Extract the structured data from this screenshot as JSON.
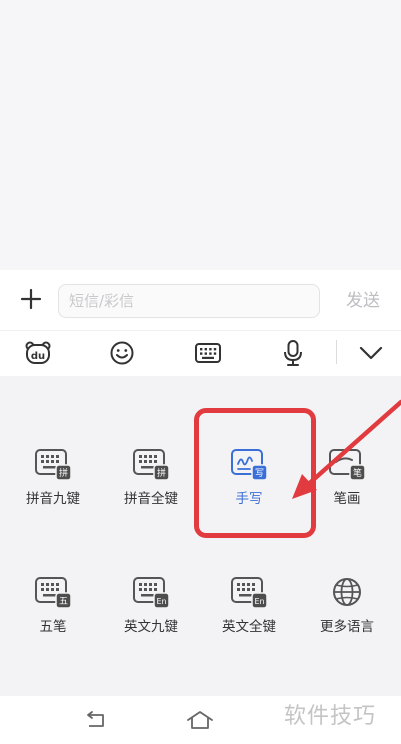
{
  "compose": {
    "placeholder": "短信/彩信",
    "send_label": "发送"
  },
  "toolbar": {
    "items": [
      {
        "name": "baidu-du-icon",
        "glyph": "du"
      },
      {
        "name": "emoji-icon"
      },
      {
        "name": "keyboard-icon"
      },
      {
        "name": "microphone-icon"
      },
      {
        "name": "chevron-down-icon"
      }
    ]
  },
  "input_modes": [
    {
      "label": "拼音九键",
      "badge": "拼",
      "icon": "keyboard-icon"
    },
    {
      "label": "拼音全键",
      "badge": "拼",
      "icon": "keyboard-icon"
    },
    {
      "label": "手写",
      "badge": "写",
      "icon": "handwriting-icon",
      "active": true
    },
    {
      "label": "笔画",
      "badge": "笔",
      "icon": "stroke-icon"
    },
    {
      "label": "五笔",
      "badge": "五",
      "icon": "keyboard-icon"
    },
    {
      "label": "英文九键",
      "badge": "En",
      "icon": "keyboard-icon"
    },
    {
      "label": "英文全键",
      "badge": "En",
      "icon": "keyboard-icon"
    },
    {
      "label": "更多语言",
      "icon": "globe-icon"
    }
  ],
  "annotation": {
    "highlight_color": "#e23b3f"
  },
  "colors": {
    "accent": "#3b6fd8",
    "icon_gray": "#555555",
    "badge_gray": "#4d4d4d"
  },
  "watermark": "软件技巧"
}
